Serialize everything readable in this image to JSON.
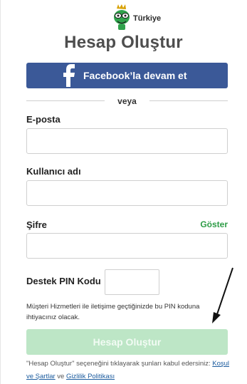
{
  "logo": {
    "country": "Türkiye",
    "icon": "mascot-logo-icon"
  },
  "title": "Hesap Oluştur",
  "facebook": {
    "label": "Facebook’la devam et",
    "icon": "facebook-icon",
    "color": "#3b5998"
  },
  "divider": {
    "text": "veya"
  },
  "fields": {
    "email": {
      "label": "E-posta",
      "value": ""
    },
    "username": {
      "label": "Kullanıcı adı",
      "value": ""
    },
    "password": {
      "label": "Şifre",
      "value": "",
      "show_label": "Göster"
    },
    "pin": {
      "label": "Destek PIN Kodu",
      "value": ""
    }
  },
  "pin_help": "Müşteri Hizmetleri ile iletişime geçtiğinizde bu PIN koduna ihtiyacınız olacak.",
  "submit": {
    "label": "Hesap Oluştur",
    "color": "#bde6c6"
  },
  "terms": {
    "prefix": "\"Hesap Oluştur\" seçeneğini tıklayarak şunları kabul edersiniz:",
    "link1": "Koşul ve Şartlar",
    "middle": "ve",
    "link2": "Gizlilik Politikası"
  },
  "colors": {
    "accent_green": "#2d9c46",
    "link_blue": "#1b5b9e"
  }
}
